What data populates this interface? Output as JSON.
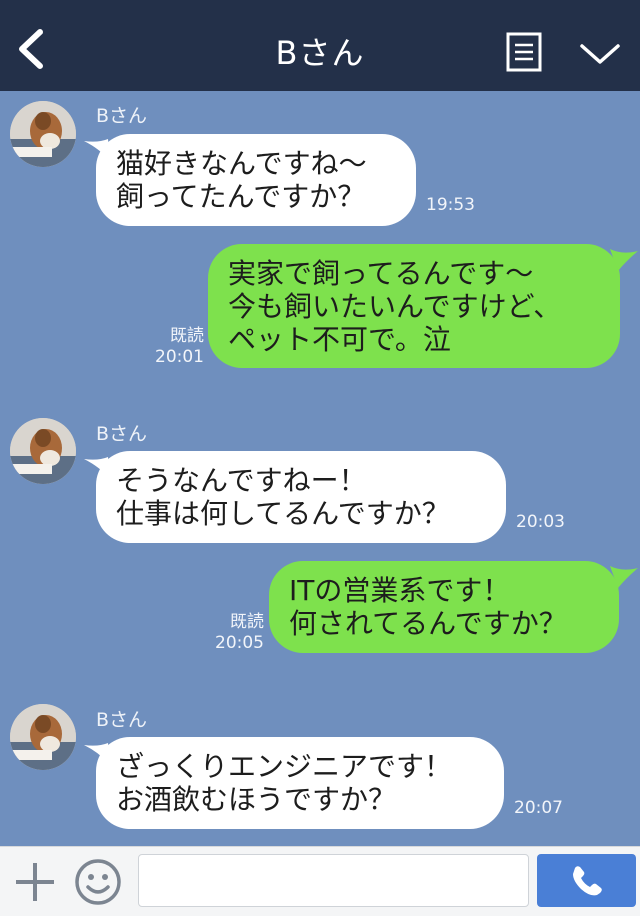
{
  "header": {
    "title": "Bさん",
    "back_icon": "chevron-left-icon",
    "menu_icon": "notes-icon",
    "collapse_icon": "chevron-down-icon"
  },
  "messages": [
    {
      "direction": "in",
      "sender": "Bさん",
      "text": "猫好きなんですね〜\n飼ってたんですか？",
      "time": "19:53"
    },
    {
      "direction": "out",
      "read": "既読",
      "text": "実家で飼ってるんです〜\n今も飼いたいんですけど、\nペット不可で。泣",
      "time": "20:01"
    },
    {
      "direction": "in",
      "sender": "Bさん",
      "text": "そうなんですねー！\n仕事は何してるんですか？",
      "time": "20:03"
    },
    {
      "direction": "out",
      "read": "既読",
      "text": "ITの営業系です！\n何されてるんですか？",
      "time": "20:05"
    },
    {
      "direction": "in",
      "sender": "Bさん",
      "text": "ざっくりエンジニアです！\nお酒飲むほうですか？",
      "time": "20:07"
    }
  ],
  "footer": {
    "input_value": "",
    "plus_icon": "plus-icon",
    "emoji_icon": "smiley-icon",
    "send_icon": "phone-icon"
  },
  "colors": {
    "header_bg": "#233049",
    "chat_bg": "#6f8fbe",
    "incoming_bubble": "#ffffff",
    "outgoing_bubble": "#7ee14d",
    "send_button": "#4a7fd6"
  }
}
